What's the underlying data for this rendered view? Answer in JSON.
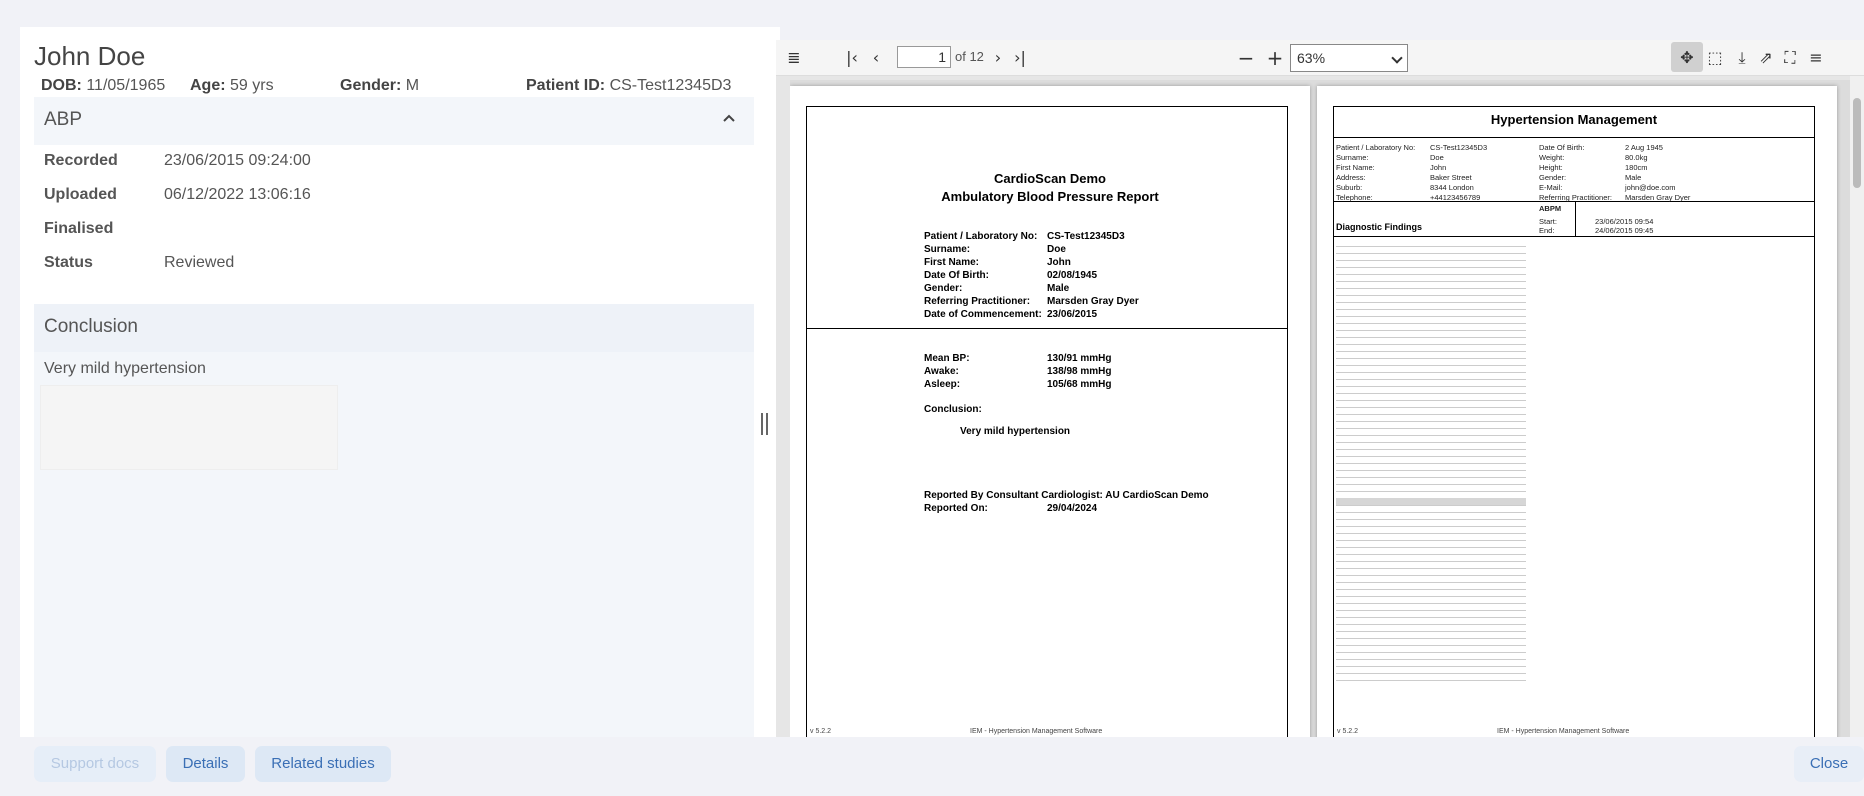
{
  "patient": {
    "name": "John Doe",
    "dob_label": "DOB:",
    "dob": "11/05/1965",
    "age_label": "Age:",
    "age": "59 yrs",
    "gender_label": "Gender:",
    "gender": "M",
    "id_label": "Patient ID:",
    "id": "CS-Test12345D3"
  },
  "abp": {
    "title": "ABP",
    "rows": [
      {
        "label": "Recorded",
        "value": "23/06/2015 09:24:00"
      },
      {
        "label": "Uploaded",
        "value": "06/12/2022 13:06:16"
      },
      {
        "label": "Finalised",
        "value": ""
      },
      {
        "label": "Status",
        "value": "Reviewed"
      }
    ]
  },
  "conclusion": {
    "title": "Conclusion",
    "text": "Very mild hypertension"
  },
  "viewer": {
    "page_current": "1",
    "page_of": "of 12",
    "zoom": "63%"
  },
  "report_page1": {
    "title1": "CardioScan Demo",
    "title2": "Ambulatory Blood Pressure Report",
    "fields": [
      {
        "k": "Patient / Laboratory No:",
        "v": "CS-Test12345D3"
      },
      {
        "k": "Surname:",
        "v": "Doe"
      },
      {
        "k": "First Name:",
        "v": "John"
      },
      {
        "k": "Date Of Birth:",
        "v": "02/08/1945"
      },
      {
        "k": "Gender:",
        "v": "Male"
      },
      {
        "k": "Referring Practitioner:",
        "v": "Marsden Gray Dyer"
      },
      {
        "k": "Date of Commencement:",
        "v": "23/06/2015"
      }
    ],
    "bp": [
      {
        "k": "Mean BP:",
        "v": "130/91 mmHg"
      },
      {
        "k": "Awake:",
        "v": "138/98 mmHg"
      },
      {
        "k": "Asleep:",
        "v": "105/68 mmHg"
      }
    ],
    "conclusion_label": "Conclusion:",
    "conclusion": "Very mild hypertension",
    "reported_by": "Reported By Consultant Cardiologist: AU CardioScan Demo",
    "reported_on_label": "Reported On:",
    "reported_on": "29/04/2024",
    "version": "v 5.2.2",
    "footer": "IEM - Hypertension Management Software"
  },
  "report_page2": {
    "title": "Hypertension Management",
    "left": [
      {
        "k": "Patient / Laboratory No:",
        "v": "CS-Test12345D3"
      },
      {
        "k": "Surname:",
        "v": "Doe"
      },
      {
        "k": "First Name:",
        "v": "John"
      },
      {
        "k": "Address:",
        "v": "Baker Street"
      },
      {
        "k": "Suburb:",
        "v": "8344 London"
      },
      {
        "k": "Telephone:",
        "v": "+44123456789"
      }
    ],
    "right": [
      {
        "k": "Date Of Birth:",
        "v": "2 Aug 1945"
      },
      {
        "k": "Weight:",
        "v": "80.0kg"
      },
      {
        "k": "Height:",
        "v": "180cm"
      },
      {
        "k": "Gender:",
        "v": "Male"
      },
      {
        "k": "E-Mail:",
        "v": "john@doe.com"
      },
      {
        "k": "Referring Practitioner:",
        "v": "Marsden Gray Dyer"
      }
    ],
    "diagnostic": "Diagnostic Findings",
    "abpm": "ABPM",
    "start_label": "Start:",
    "start": "23/06/2015 09:54",
    "end_label": "End:",
    "end": "24/06/2015 09:45",
    "version": "v 5.2.2",
    "footer": "IEM - Hypertension Management Software"
  },
  "buttons": {
    "support": "Support docs",
    "details": "Details",
    "related": "Related studies",
    "close": "Close"
  }
}
